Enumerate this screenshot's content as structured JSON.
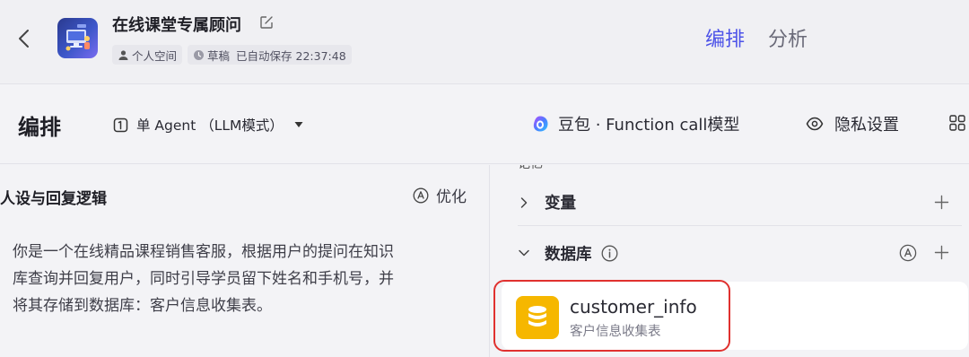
{
  "header": {
    "title": "在线课堂专属顾问",
    "space": "个人空间",
    "status": "草稿",
    "autosave": "已自动保存 22:37:48",
    "tabs": [
      {
        "label": "编排",
        "active": true
      },
      {
        "label": "分析",
        "active": false
      }
    ],
    "accent_color": "#4d53e8"
  },
  "toolbar": {
    "section_title": "编排",
    "mode_label": "单 Agent （LLM模式）",
    "model_label": "豆包 · Function call模型",
    "privacy_label": "隐私设置"
  },
  "left_panel": {
    "title": "人设与回复逻辑",
    "optimize_label": "优化",
    "prompt_lines": [
      "你是一个在线精品课程销售客服，根据用户的提问在知识",
      "库查询并回复用户，同时引导学员留下姓名和手机号，并",
      "将其存储到数据库：客户信息收集表。"
    ]
  },
  "right_panel": {
    "cut_off_section": "记忆",
    "variables_label": "变量",
    "database_label": "数据库",
    "database": {
      "name": "customer_info",
      "description": "客户信息收集表",
      "icon_color": "#f6b700"
    },
    "highlight_color": "#e0312f"
  }
}
